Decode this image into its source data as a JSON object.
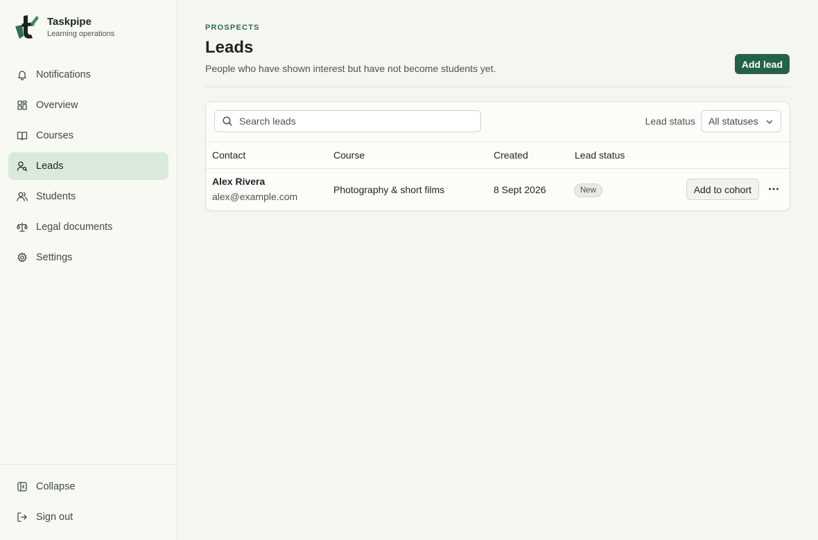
{
  "brand": {
    "name": "Taskpipe",
    "subtitle": "Learning operations"
  },
  "sidebar": {
    "items": [
      {
        "label": "Notifications",
        "icon": "bell-icon"
      },
      {
        "label": "Overview",
        "icon": "grid-icon"
      },
      {
        "label": "Courses",
        "icon": "book-icon"
      },
      {
        "label": "Leads",
        "icon": "user-search-icon",
        "active": true
      },
      {
        "label": "Students",
        "icon": "users-icon"
      },
      {
        "label": "Legal documents",
        "icon": "scale-icon"
      },
      {
        "label": "Settings",
        "icon": "gear-icon"
      }
    ],
    "footer": [
      {
        "label": "Collapse",
        "icon": "collapse-icon"
      },
      {
        "label": "Sign out",
        "icon": "sign-out-icon"
      }
    ]
  },
  "header": {
    "eyebrow": "PROSPECTS",
    "title": "Leads",
    "description": "People who have shown interest but have not become students yet.",
    "add_button": "Add lead"
  },
  "toolbar": {
    "search_placeholder": "Search leads",
    "filter_label": "Lead status",
    "filter_value": "All statuses"
  },
  "table": {
    "columns": [
      "Contact",
      "Course",
      "Created",
      "Lead status"
    ],
    "rows": [
      {
        "name": "Alex Rivera",
        "email": "alex@example.com",
        "course": "Photography & short films",
        "created": "8 Sept 2026",
        "status": "New",
        "action": "Add to cohort"
      }
    ]
  },
  "colors": {
    "accent": "#24614a",
    "active_nav_bg": "#d9eadc",
    "sidebar_bg": "#f7f9f2",
    "page_bg": "#f6f6f0"
  }
}
